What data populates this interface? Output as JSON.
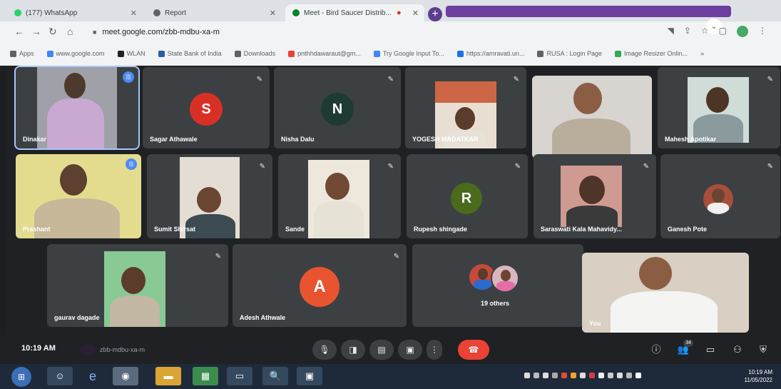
{
  "tabs": [
    {
      "label": "(177) WhatsApp",
      "fav_color": "#25d366"
    },
    {
      "label": "Report",
      "fav_color": "#5f6368"
    },
    {
      "label": "Meet - Bird Saucer Distrib...",
      "fav_color": "#00832d"
    }
  ],
  "url": "meet.google.com/zbb-mdbu-xa-m",
  "bookmarks": [
    {
      "label": "Apps",
      "color": "#5f6368"
    },
    {
      "label": "www.google.com",
      "color": "#4285f4"
    },
    {
      "label": "WLAN",
      "color": "#202124"
    },
    {
      "label": "State Bank of India",
      "color": "#2a5ca8"
    },
    {
      "label": "Downloads",
      "color": "#5f6368"
    },
    {
      "label": "pnthhdawaraut@gm...",
      "color": "#ea4335"
    },
    {
      "label": "Try Google Input To...",
      "color": "#4285f4"
    },
    {
      "label": "https://amravati.un...",
      "color": "#1a73e8"
    },
    {
      "label": "RUSA : Login Page",
      "color": "#5f6368"
    },
    {
      "label": "Image Resizer Onlin...",
      "color": "#34a853"
    }
  ],
  "participants": {
    "dinkar": "Dinakar",
    "sagar": "Sagar Athawale",
    "sagar_initial": "S",
    "nisha": "Nisha Dalu",
    "nisha_initial": "N",
    "yogesh": "YOGESH MADATKAR",
    "p5": "",
    "mahesh": "Mahesh Apotikar",
    "prashant": "Prashant",
    "sumit": "Sumit Shirsat",
    "sande": "Sande",
    "rupesh": "Rupesh shingade",
    "rupesh_initial": "R",
    "saraswati": "Saraswati Kala Mahavidy...",
    "ganesh": "Ganesh Pote",
    "gaurav": "gaurav dagade",
    "adesh": "Adesh Athwale",
    "adesh_initial": "A",
    "others": "19 others",
    "you": "You"
  },
  "colors": {
    "sagar": "#d93025",
    "nisha": "#1e3a34",
    "rupesh": "#4a6b1c",
    "adesh": "#e8542f"
  },
  "bottom": {
    "clock": "10:19 AM",
    "meet_code": "zbb-mdbu-xa-m",
    "people_count": "34"
  },
  "taskbar": {
    "time": "10:19 AM",
    "date": "11/05/2022"
  }
}
